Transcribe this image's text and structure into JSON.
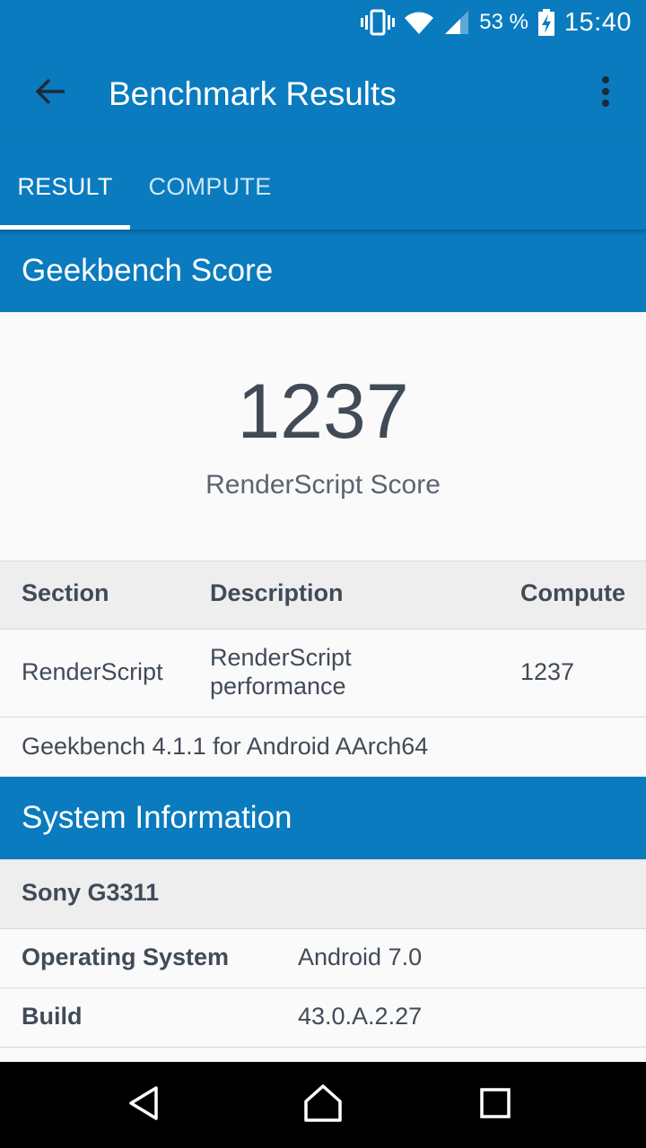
{
  "status_bar": {
    "battery_percent": "53 %",
    "time": "15:40",
    "icons": [
      "vibrate-icon",
      "wifi-icon",
      "signal-icon",
      "battery-charging-icon"
    ]
  },
  "app_bar": {
    "title": "Benchmark Results",
    "back_icon": "arrow-back-icon",
    "overflow_icon": "more-vert-icon"
  },
  "tabs": [
    {
      "label": "RESULT",
      "selected": true
    },
    {
      "label": "COMPUTE",
      "selected": false
    }
  ],
  "score_section": {
    "header": "Geekbench Score",
    "score": "1237",
    "score_label": "RenderScript Score"
  },
  "results_table": {
    "columns": [
      "Section",
      "Description",
      "Compute"
    ],
    "rows": [
      {
        "section": "RenderScript",
        "description_line1": "RenderScript",
        "description_line2": "performance",
        "compute": "1237"
      }
    ],
    "footer": "Geekbench 4.1.1 for Android AArch64"
  },
  "system_info": {
    "header": "System Information",
    "device": "Sony G3311",
    "rows": [
      {
        "label": "Operating System",
        "value": "Android 7.0"
      },
      {
        "label": "Build",
        "value": "43.0.A.2.27"
      }
    ]
  },
  "nav_bar": {
    "icons": [
      "back-triangle-icon",
      "home-icon",
      "recents-icon"
    ]
  },
  "colors": {
    "primary": "#0a7bbf",
    "text": "#414b57",
    "row_gray": "#eeeeee"
  }
}
